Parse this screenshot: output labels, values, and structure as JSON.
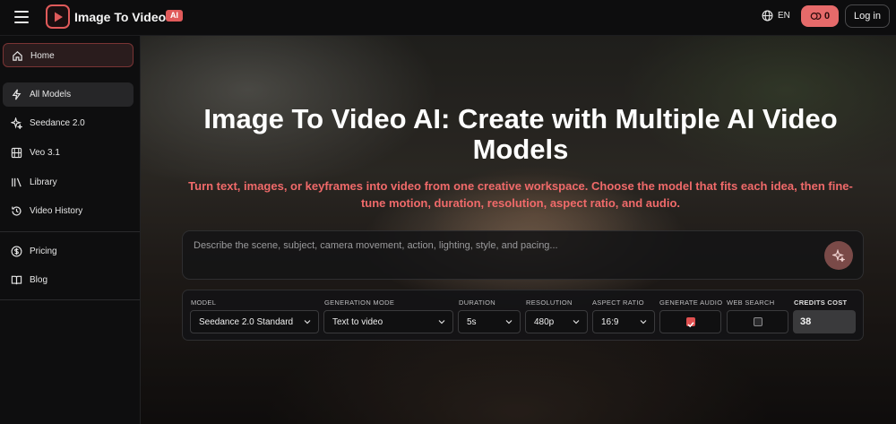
{
  "header": {
    "brand": "Image To Video",
    "badge": "AI",
    "language": "EN",
    "credits": "0",
    "login_label": "Log in"
  },
  "sidebar": {
    "items": [
      {
        "label": "Home",
        "icon": "home-icon"
      },
      {
        "label": "All Models",
        "icon": "bolt-icon"
      },
      {
        "label": "Seedance 2.0",
        "icon": "sparkle-icon"
      },
      {
        "label": "Veo 3.1",
        "icon": "film-icon"
      },
      {
        "label": "Library",
        "icon": "library-icon"
      },
      {
        "label": "Video History",
        "icon": "history-icon"
      },
      {
        "label": "Pricing",
        "icon": "dollar-icon"
      },
      {
        "label": "Blog",
        "icon": "book-icon"
      }
    ]
  },
  "hero": {
    "title": "Image To Video AI: Create with Multiple AI Video Models",
    "subtitle": "Turn text, images, or keyframes into video from one creative workspace. Choose the model that fits each idea, then fine-tune motion, duration, resolution, aspect ratio, and audio."
  },
  "prompt": {
    "placeholder": "Describe the scene, subject, camera movement, action, lighting, style, and pacing..."
  },
  "controls": {
    "model": {
      "label": "MODEL",
      "value": "Seedance 2.0 Standard"
    },
    "mode": {
      "label": "GENERATION MODE",
      "value": "Text to video"
    },
    "duration": {
      "label": "DURATION",
      "value": "5s"
    },
    "resolution": {
      "label": "RESOLUTION",
      "value": "480p"
    },
    "aspect": {
      "label": "ASPECT RATIO",
      "value": "16:9"
    },
    "audio": {
      "label": "GENERATE AUDIO",
      "checked": true
    },
    "web": {
      "label": "WEB SEARCH",
      "checked": false
    },
    "cost": {
      "label": "CREDITS COST",
      "value": "38"
    }
  },
  "colors": {
    "accent": "#e05a5a",
    "subtitle": "#f06a6a",
    "credits_button": "#e66a6a"
  }
}
